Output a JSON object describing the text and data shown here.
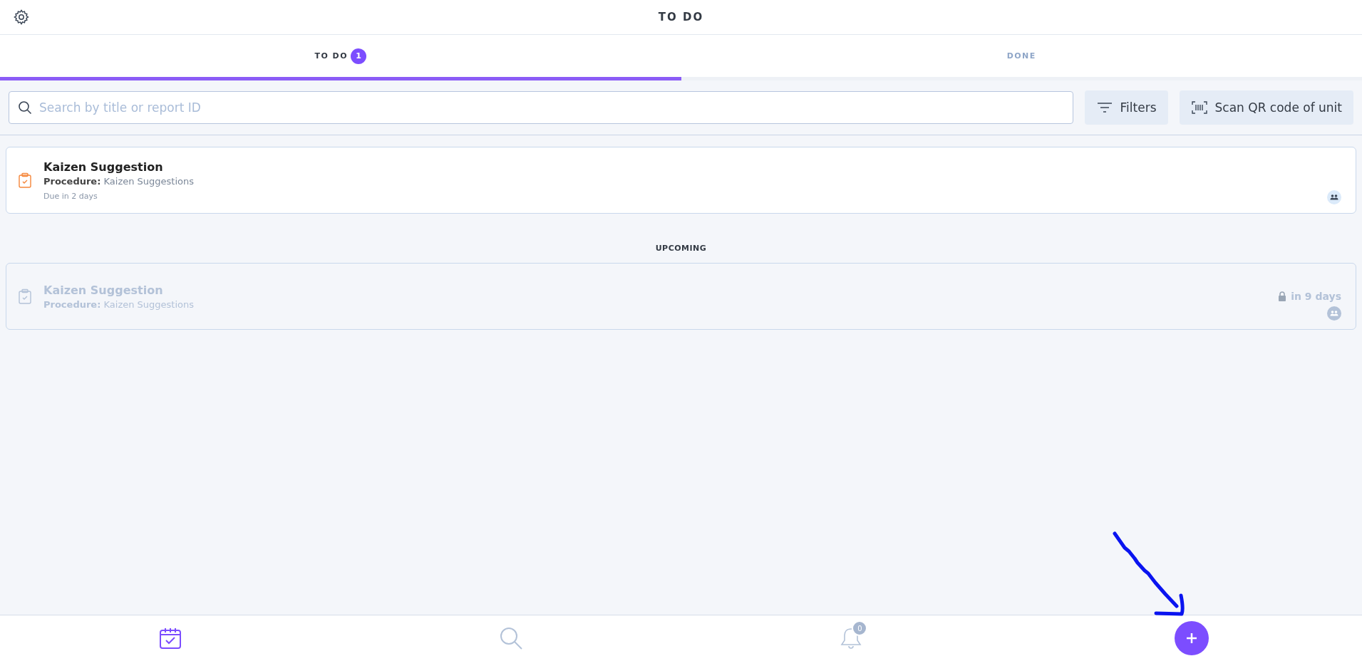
{
  "header": {
    "title": "TO DO"
  },
  "tabs": [
    {
      "label": "TO DO",
      "badge": "1",
      "selected": true
    },
    {
      "label": "DONE",
      "selected": false
    }
  ],
  "search": {
    "placeholder": "Search by title or report ID"
  },
  "buttons": [
    {
      "kind": "filter",
      "label": "Filters"
    },
    {
      "kind": "scan",
      "label": "Scan QR code of unit"
    }
  ],
  "tasks": [
    {
      "title": "Kaizen Suggestion",
      "procedure_label": "Procedure:",
      "procedure": "Kaizen Suggestions",
      "due": "Due in 2 days",
      "locked": false
    }
  ],
  "upcoming": {
    "heading": "UPCOMING",
    "tasks": [
      {
        "title": "Kaizen Suggestion",
        "procedure_label": "Procedure:",
        "procedure": "Kaizen Suggestions",
        "when": "in 9 days",
        "locked": true
      }
    ]
  },
  "bottom_nav": [
    {
      "kind": "calendar",
      "selected": true
    },
    {
      "kind": "search",
      "selected": false
    },
    {
      "kind": "bell",
      "badge": "0",
      "selected": false
    },
    {
      "kind": "add"
    }
  ]
}
